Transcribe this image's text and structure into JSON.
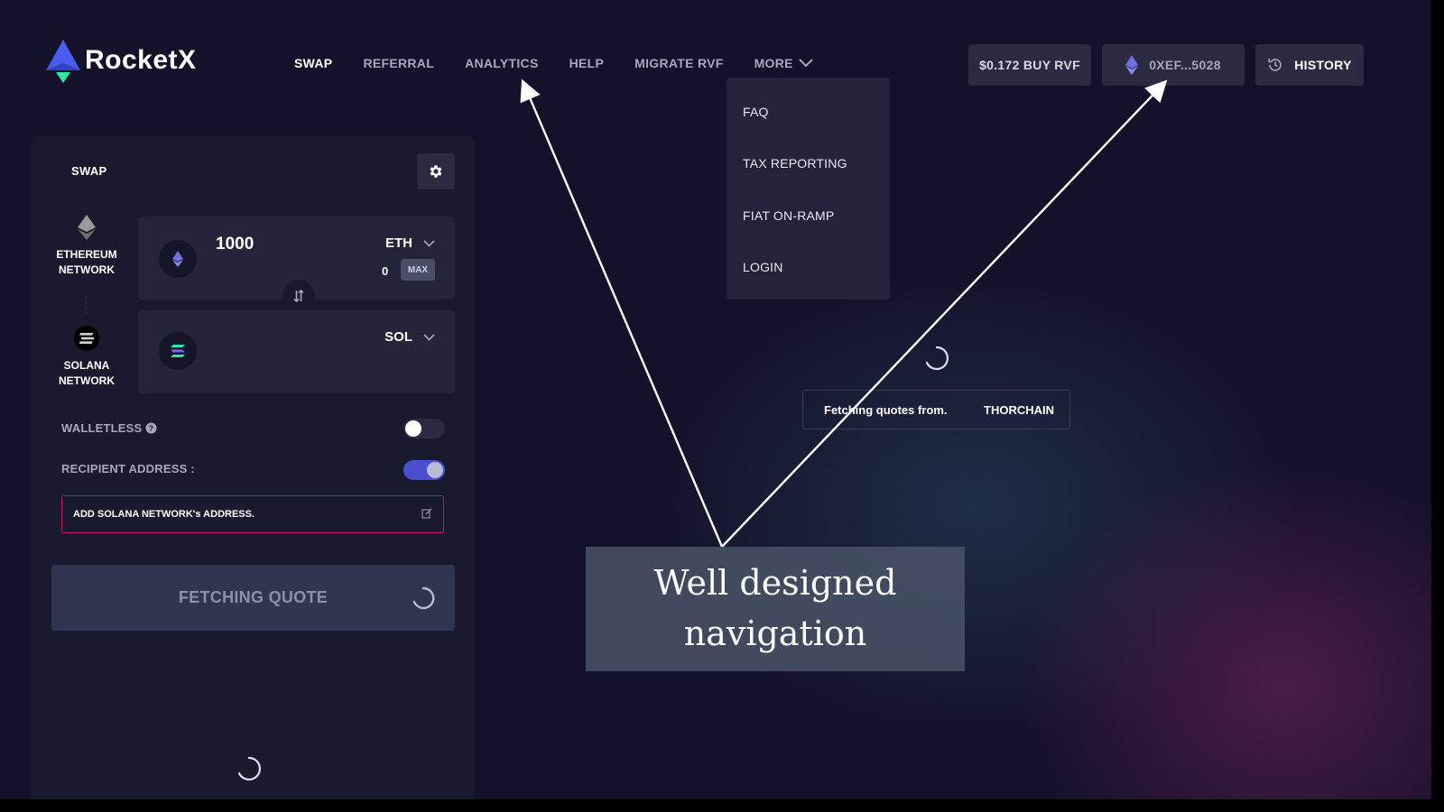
{
  "brand": {
    "name": "RocketX"
  },
  "nav": {
    "items": [
      {
        "label": "SWAP",
        "active": true
      },
      {
        "label": "REFERRAL",
        "active": false
      },
      {
        "label": "ANALYTICS",
        "active": false
      },
      {
        "label": "HELP",
        "active": false
      },
      {
        "label": "MIGRATE RVF",
        "active": false
      }
    ],
    "more_label": "MORE",
    "more_icon": "chevron-down-icon"
  },
  "header_buttons": {
    "buy": "$0.172 BUY RVF",
    "wallet": "0XEF...5028",
    "wallet_icon": "ethereum-icon",
    "history": "HISTORY",
    "history_icon": "history-icon"
  },
  "more_menu": {
    "items": [
      "FAQ",
      "TAX REPORTING",
      "FIAT ON-RAMP",
      "LOGIN"
    ]
  },
  "swap": {
    "title": "SWAP",
    "settings_icon": "gear-icon",
    "from": {
      "network_line1": "ETHEREUM",
      "network_line2": "NETWORK",
      "amount": "1000",
      "token": "ETH",
      "balance": "0",
      "max_label": "MAX"
    },
    "to": {
      "network_line1": "SOLANA",
      "network_line2": "NETWORK",
      "token": "SOL"
    },
    "walletless_label": "WALLETLESS",
    "walletless_on": false,
    "recipient_label": "RECIPIENT ADDRESS :",
    "recipient_on": true,
    "address_placeholder": "ADD SOLANA NETWORK's ADDRESS.",
    "fetch_label": "FETCHING QUOTE"
  },
  "quote_status": {
    "label": "Fetching quotes from.",
    "source": "THORCHAIN"
  },
  "caption": {
    "line1": "Well designed",
    "line2": "navigation"
  },
  "colors": {
    "background": "#14112a",
    "panel": "#1a1a2e",
    "accent_pink": "#c2185b",
    "toggle_on": "#4a4fd0",
    "logo_blue": "#4b5cf0",
    "logo_green": "#2ee6a8"
  }
}
